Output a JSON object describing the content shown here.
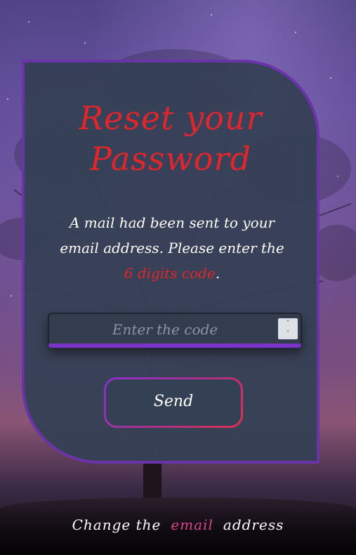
{
  "card": {
    "title_line1": "Reset your",
    "title_line2": "Password",
    "message_start": "A mail had been sent to your email address. Please enter the ",
    "message_highlight": "6 digits code",
    "message_end": ".",
    "code_input": {
      "placeholder": "Enter the code",
      "value": ""
    },
    "send_label": "Send"
  },
  "footer": {
    "prefix": "Change the",
    "link": "email",
    "suffix": "address"
  },
  "colors": {
    "accent_red": "#e0262b",
    "accent_purple": "#6a34a8",
    "link_pink": "#e0418e",
    "card_bg": "#344054"
  },
  "icons": {
    "stepper_up": "chevron-up-icon",
    "stepper_down": "chevron-down-icon"
  }
}
